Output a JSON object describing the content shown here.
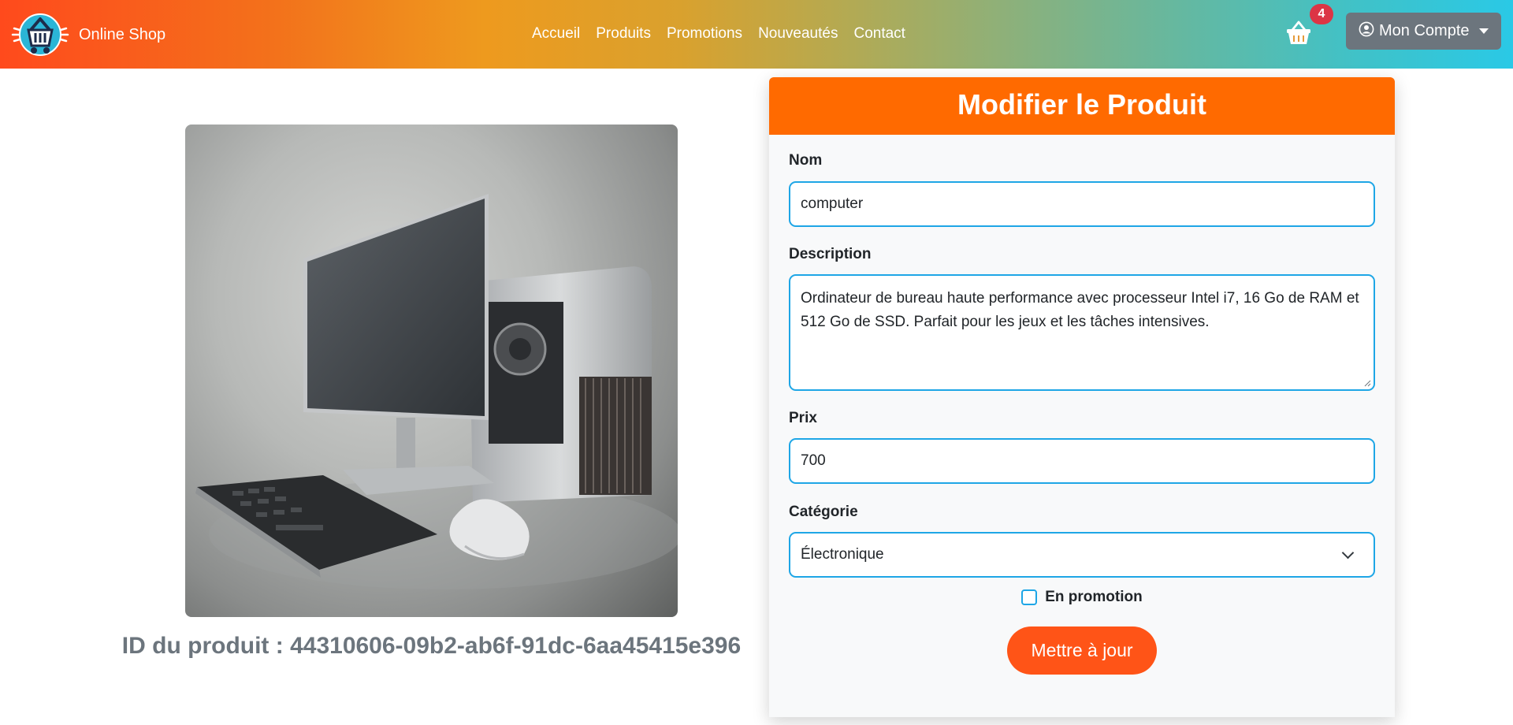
{
  "navbar": {
    "brand": "Online Shop",
    "links": [
      "Accueil",
      "Produits",
      "Promotions",
      "Nouveautés",
      "Contact"
    ],
    "cart_count": "4",
    "account_label": "Mon Compte"
  },
  "product": {
    "id_text": "ID du produit : 44310606-09b2-ab6f-91dc-6aa45415e396"
  },
  "form": {
    "title": "Modifier le Produit",
    "name_label": "Nom",
    "name_value": "computer",
    "description_label": "Description",
    "description_value": "Ordinateur de bureau haute performance avec processeur Intel i7, 16 Go de RAM et 512 Go de SSD. Parfait pour les jeux et les tâches intensives.",
    "price_label": "Prix",
    "price_value": "700",
    "category_label": "Catégorie",
    "category_value": "Électronique",
    "promo_label": "En promotion",
    "promo_checked": false,
    "submit_label": "Mettre à jour"
  },
  "colors": {
    "header_orange": "#ff6a00",
    "button_orange": "#ff5417",
    "input_border": "#1ea6e6",
    "badge_red": "#dc3545",
    "account_gray": "#6c757d"
  }
}
